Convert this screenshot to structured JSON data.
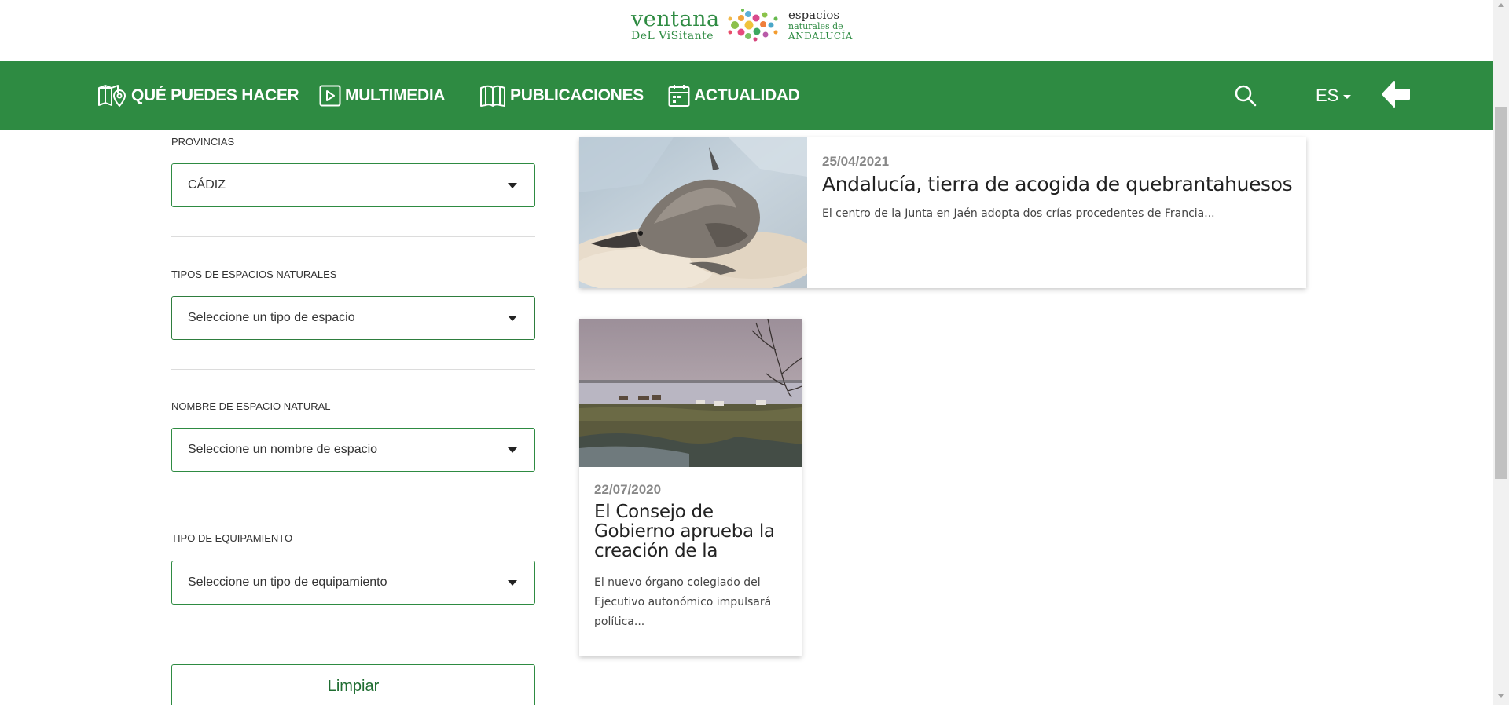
{
  "logo": {
    "line1": "ventana",
    "line2": "DeL ViSitante",
    "right1": "espacios",
    "right2": "naturales de",
    "right3": "ANDALUCÍA"
  },
  "nav": {
    "items": [
      {
        "label": "QUÉ PUEDES HACER",
        "icon": "map-pin-icon"
      },
      {
        "label": "MULTIMEDIA",
        "icon": "play-icon"
      },
      {
        "label": "PUBLICACIONES",
        "icon": "book-icon"
      },
      {
        "label": "ACTUALIDAD",
        "icon": "calendar-icon"
      }
    ],
    "search_icon": "search-icon",
    "language": "ES",
    "back_icon": "arrow-left-icon"
  },
  "filters": {
    "provincias": {
      "label": "PROVINCIAS",
      "value": "CÁDIZ"
    },
    "tipos": {
      "label": "TIPOS DE ESPACIOS NATURALES",
      "value": "Seleccione un tipo de espacio"
    },
    "nombre": {
      "label": "NOMBRE DE ESPACIO NATURAL",
      "value": "Seleccione un nombre de espacio"
    },
    "equipamiento": {
      "label": "TIPO DE EQUIPAMIENTO",
      "value": "Seleccione un tipo de equipamiento"
    },
    "clear_button": "Limpiar"
  },
  "news": [
    {
      "date": "25/04/2021",
      "title": "Andalucía, tierra de acogida de quebrantahuesos",
      "desc": "El centro de la Junta en Jaén adopta dos crías procedentes de Francia..."
    },
    {
      "date": "22/07/2020",
      "title": "El Consejo de Gobierno aprueba la creación de la",
      "desc": "El nuevo órgano colegiado del Ejecutivo autonómico impulsará política..."
    }
  ],
  "colors": {
    "brand_green": "#2e8b42",
    "text_dark": "#222222",
    "date_grey": "#888888"
  }
}
